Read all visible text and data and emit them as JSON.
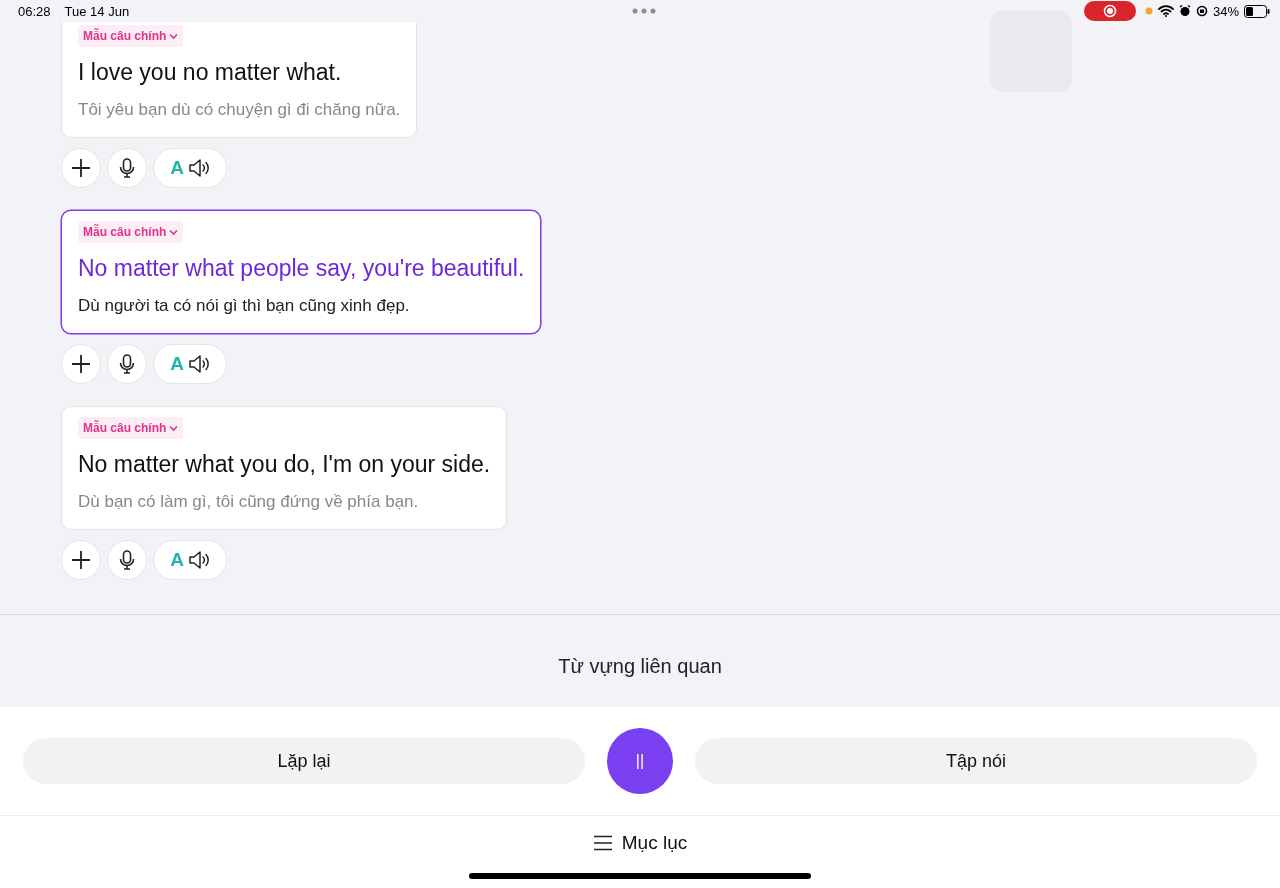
{
  "status_bar": {
    "time": "06:28",
    "date": "Tue 14 Jun",
    "battery": "34%"
  },
  "sentences": [
    {
      "tag": "Mẫu câu chính",
      "text": "I love you no matter what.",
      "translation": "Tôi yêu bạn dù có chuyện gì đi chăng nữa.",
      "speak_letter": "A",
      "selected": false
    },
    {
      "tag": "Mẫu câu chính",
      "text": "No matter what people say, you're beautiful.",
      "translation": "Dù người ta có nói gì thì bạn cũng xinh đẹp.",
      "speak_letter": "A",
      "selected": true
    },
    {
      "tag": "Mẫu câu chính",
      "text": "No matter what you do, I'm on your side.",
      "translation": "Dù bạn có làm gì, tôi cũng đứng về phía bạn.",
      "speak_letter": "A",
      "selected": false
    }
  ],
  "related_heading": "Từ vựng liên quan",
  "controls": {
    "repeat": "Lặp lại",
    "pause": "||",
    "practice": "Tập nói"
  },
  "menu": {
    "label": "Mục lục"
  }
}
